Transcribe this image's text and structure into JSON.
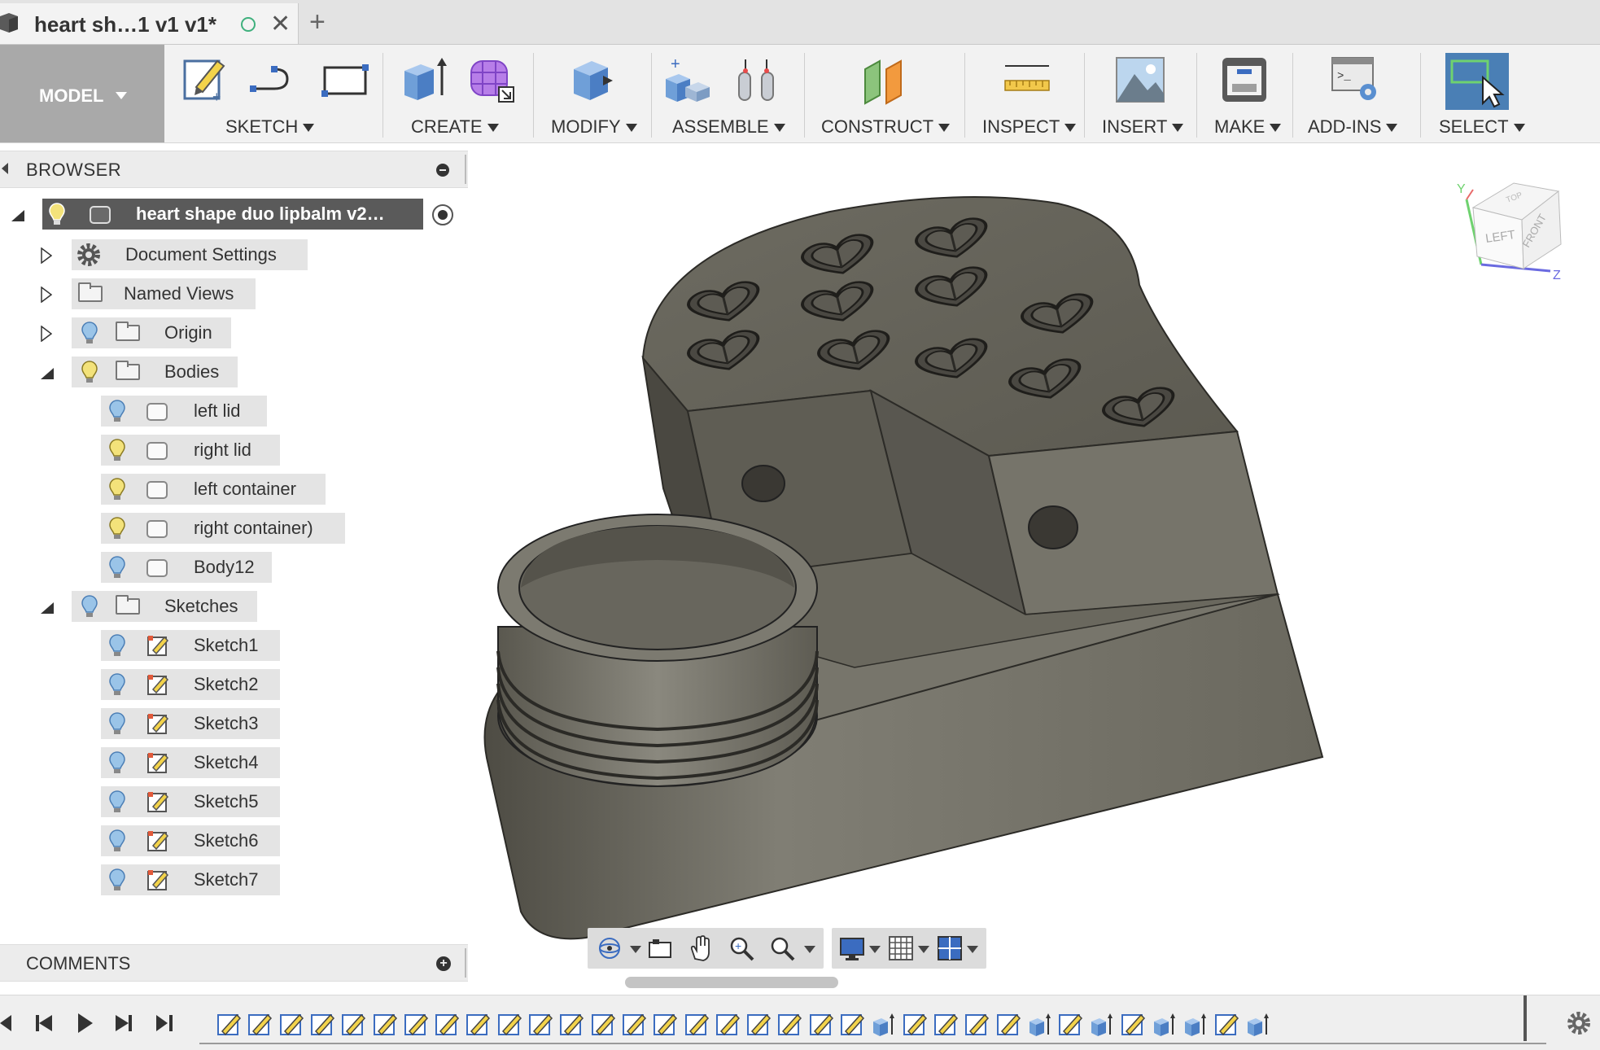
{
  "tab": {
    "title": "heart sh…1 v1 v1*",
    "close_glyph": "✕",
    "new_tab_glyph": "+"
  },
  "toolbar": {
    "model_label": "MODEL",
    "groups": [
      {
        "label": "SKETCH",
        "icons": [
          "create-sketch-icon",
          "line-icon",
          "rectangle-icon"
        ]
      },
      {
        "label": "CREATE",
        "icons": [
          "extrude-icon",
          "form-icon"
        ]
      },
      {
        "label": "MODIFY",
        "icons": [
          "press-pull-icon"
        ]
      },
      {
        "label": "ASSEMBLE",
        "icons": [
          "new-component-icon",
          "joint-icon"
        ]
      },
      {
        "label": "CONSTRUCT",
        "icons": [
          "offset-plane-icon"
        ]
      },
      {
        "label": "INSPECT",
        "icons": [
          "measure-icon"
        ]
      },
      {
        "label": "INSERT",
        "icons": [
          "attached-canvas-icon"
        ]
      },
      {
        "label": "MAKE",
        "icons": [
          "3d-print-icon"
        ]
      },
      {
        "label": "ADD-INS",
        "icons": [
          "scripts-icon"
        ]
      },
      {
        "label": "SELECT",
        "icons": [
          "select-icon"
        ]
      }
    ]
  },
  "browser": {
    "title": "BROWSER",
    "root": "heart shape duo lipbalm v2…",
    "items": {
      "document_settings": "Document Settings",
      "named_views": "Named Views",
      "origin": "Origin",
      "bodies": "Bodies",
      "sketches": "Sketches"
    },
    "bodies": [
      "left lid",
      "right lid",
      "left container",
      "right container)",
      "Body12"
    ],
    "sketches": [
      "Sketch1",
      "Sketch2",
      "Sketch3",
      "Sketch4",
      "Sketch5",
      "Sketch6",
      "Sketch7"
    ]
  },
  "comments": {
    "title": "COMMENTS"
  },
  "viewcube": {
    "faces": [
      "LEFT",
      "FRONT",
      "TOP"
    ],
    "axes": [
      "Y",
      "Z"
    ]
  },
  "colors": {
    "toolbar_bg": "#f2f2f2",
    "model_button": "#a9a9a9",
    "select_active": "#4a7fb5",
    "part_surface": "#6e6c62",
    "bulb_on": "#f3e27a",
    "bulb_off": "#9ac4e8"
  },
  "timeline": {
    "steps": [
      "sketch",
      "sketch",
      "sketch",
      "sketch",
      "sketch",
      "sketch",
      "sketch",
      "sketch",
      "sketch",
      "sketch",
      "sketch",
      "sketch",
      "sketch",
      "sketch",
      "sketch",
      "sketch",
      "sketch",
      "sketch",
      "sketch",
      "sketch",
      "sketch",
      "extrude",
      "sketch",
      "sketch",
      "sketch",
      "sketch",
      "extrude",
      "sketch",
      "extrude",
      "sketch",
      "extrude",
      "extrude",
      "sketch",
      "extrude"
    ]
  }
}
